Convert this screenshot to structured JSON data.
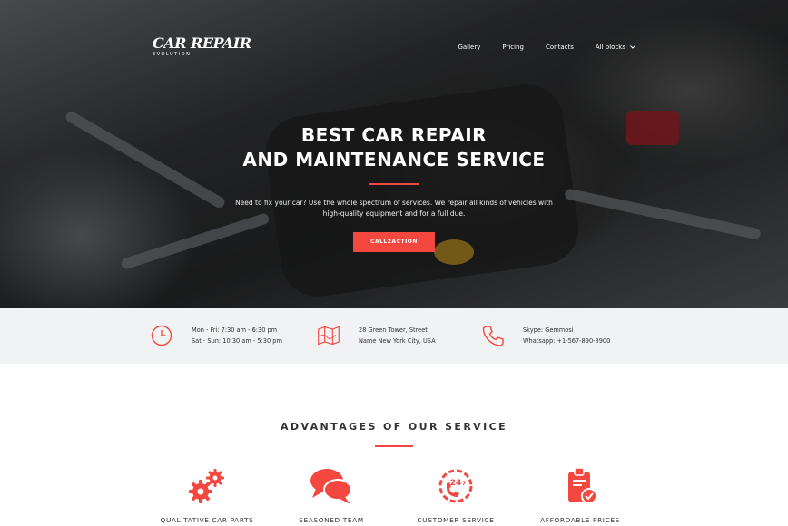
{
  "brand": {
    "name": "CAR REPAIR",
    "tagline": "EVOLUTION"
  },
  "nav": {
    "items": [
      {
        "label": "Gallery"
      },
      {
        "label": "Pricing"
      },
      {
        "label": "Contacts"
      },
      {
        "label": "All blocks",
        "icon": "chevron-down-icon"
      }
    ]
  },
  "hero": {
    "title_line1": "BEST CAR REPAIR",
    "title_line2": "AND MAINTENANCE SERVICE",
    "description": "Need to fix your car? Use the whole spectrum of services. We repair all kinds of vehicles with high-quality equipment and for a full due.",
    "cta_label": "CALL2ACTION"
  },
  "info": {
    "hours": {
      "icon": "clock-icon",
      "line1": "Mon - Fri: 7:30 am - 6:30 pm",
      "line2": "Sat - Sun: 10:30 am - 5:30 pm"
    },
    "address": {
      "icon": "map-icon",
      "line1": "28 Green Tower, Street",
      "line2": "Name New York City, USA"
    },
    "contact": {
      "icon": "phone-icon",
      "line1": "Skype: Gemmosi",
      "line2": "Whatsapp: +1-567-890-8900"
    }
  },
  "advantages": {
    "title": "ADVANTAGES OF OUR SERVICE",
    "items": [
      {
        "label": "QUALITATIVE CAR PARTS",
        "icon": "gears-icon"
      },
      {
        "label": "SEASONED TEAM",
        "icon": "chat-bubbles-icon"
      },
      {
        "label": "CUSTOMER SERVICE",
        "icon": "support-24-7-icon"
      },
      {
        "label": "AFFORDABLE PRICES",
        "icon": "clipboard-check-icon"
      }
    ]
  },
  "colors": {
    "accent": "#f4473f",
    "infobar_bg": "#f1f2f3",
    "text": "#333333"
  }
}
